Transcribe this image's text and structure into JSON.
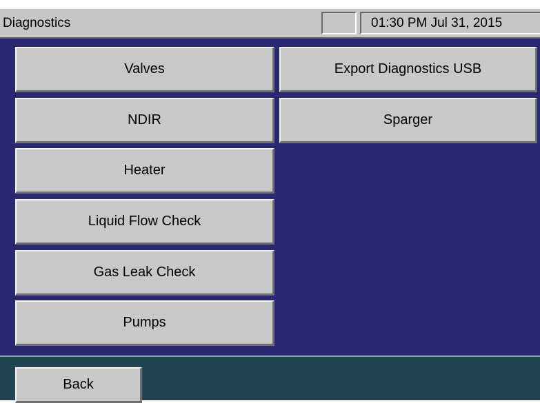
{
  "titlebar": {
    "title": "Diagnostics",
    "clock": "01:30 PM Jul 31, 2015"
  },
  "left_buttons": [
    {
      "label": "Valves"
    },
    {
      "label": "NDIR"
    },
    {
      "label": "Heater"
    },
    {
      "label": "Liquid Flow Check"
    },
    {
      "label": "Gas Leak Check"
    },
    {
      "label": "Pumps"
    }
  ],
  "right_buttons": [
    {
      "label": "Export Diagnostics USB"
    },
    {
      "label": "Sparger"
    }
  ],
  "footer": {
    "back_label": "Back"
  },
  "colors": {
    "screen_background": "#2b2872",
    "footer_background": "#204550",
    "button_face": "#c8c8c8",
    "titlebar": "#c6c6c6"
  }
}
